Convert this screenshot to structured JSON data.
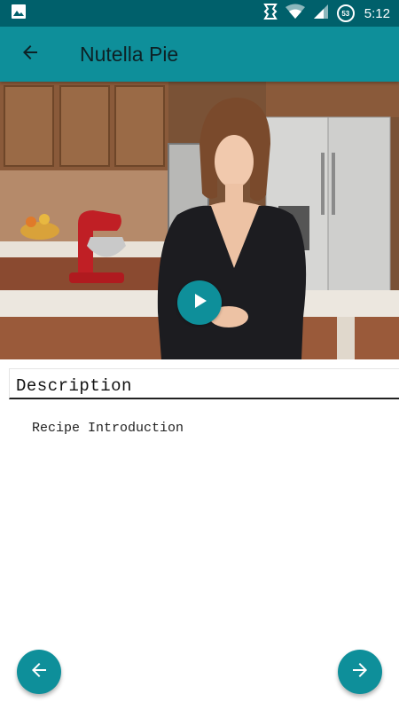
{
  "status_bar": {
    "time": "5:12",
    "battery_level": "53",
    "icons": [
      "image-icon",
      "vibrate-icon",
      "wifi-icon",
      "signal-icon",
      "battery-icon"
    ]
  },
  "app_bar": {
    "title": "Nutella Pie",
    "back_icon": "arrow-back-icon"
  },
  "video": {
    "play_icon": "play-icon"
  },
  "description": {
    "heading": "Description",
    "text": "Recipe Introduction"
  },
  "navigation": {
    "previous_icon": "arrow-left-icon",
    "next_icon": "arrow-right-icon"
  },
  "colors": {
    "status_bar": "#00606b",
    "app_bar": "#0e8f9a",
    "accent": "#0e8f9a"
  }
}
